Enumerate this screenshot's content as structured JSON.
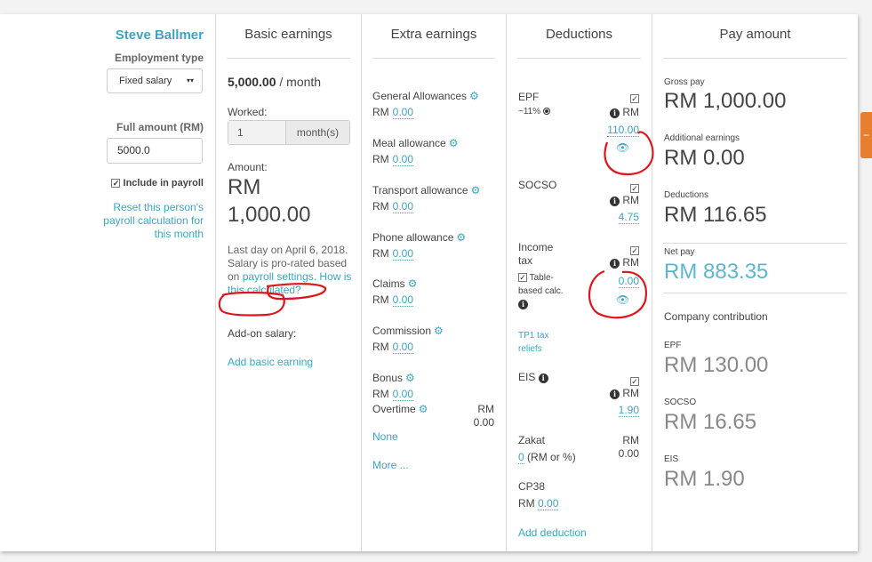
{
  "person": {
    "name": "Steve Ballmer",
    "employment_type_label": "Employment type",
    "employment_type_value": "Fixed salary",
    "full_amount_label": "Full amount (RM)",
    "full_amount_value": "5000.0",
    "include_label": "Include in payroll",
    "reset_link": "Reset this person's payroll calculation for this month"
  },
  "basic": {
    "title": "Basic earnings",
    "rate": "5,000.00",
    "rate_unit": "/ month",
    "worked_label": "Worked:",
    "worked_value": "1",
    "worked_unit": "month(s)",
    "amount_label": "Amount:",
    "amount_currency": "RM",
    "amount_value": "1,000.00",
    "note_text": "Last day on April 6, 2018. Salary is pro-rated based on",
    "note_link": "payroll settings.",
    "how_link": "How is this calculated?",
    "addon_label": "Add-on salary:",
    "add_basic": "Add basic earning"
  },
  "extra": {
    "title": "Extra earnings",
    "currency": "RM",
    "items": [
      {
        "label": "General Allowances",
        "value": "0.00"
      },
      {
        "label": "Meal allowance",
        "value": "0.00"
      },
      {
        "label": "Transport allowance",
        "value": "0.00"
      },
      {
        "label": "Phone allowance",
        "value": "0.00"
      },
      {
        "label": "Claims",
        "value": "0.00"
      },
      {
        "label": "Commission",
        "value": "0.00"
      },
      {
        "label": "Bonus",
        "value": "0.00"
      }
    ],
    "overtime_label": "Overtime",
    "overtime_currency": "RM",
    "overtime_value": "0.00",
    "none_link": "None",
    "more_link": "More ..."
  },
  "deductions": {
    "title": "Deductions",
    "currency": "RM",
    "epf_label": "EPF",
    "epf_rate": "~11%",
    "epf_value": "110.00",
    "socso_label": "SOCSO",
    "socso_value": "4.75",
    "income_tax_label_1": "Income",
    "income_tax_label_2": "tax",
    "income_tax_value": "0.00",
    "table_calc_1": "Table-",
    "table_calc_2": "based calc.",
    "tp1_link_1": "TP1 tax",
    "tp1_link_2": "reliefs",
    "eis_label": "EIS",
    "eis_value": "1.90",
    "zakat_label": "Zakat",
    "zakat_input": "0",
    "zakat_hint": "(RM or %)",
    "zakat_currency": "RM",
    "zakat_value": "0.00",
    "cp38_label": "CP38",
    "cp38_currency": "RM",
    "cp38_value": "0.00",
    "add_deduction": "Add deduction"
  },
  "pay": {
    "title": "Pay amount",
    "gross_label": "Gross pay",
    "gross_value": "RM 1,000.00",
    "additional_label": "Additional earnings",
    "additional_value": "RM 0.00",
    "deductions_label": "Deductions",
    "deductions_value": "RM 116.65",
    "net_label": "Net pay",
    "net_value": "RM 883.35",
    "company_label": "Company contribution",
    "c_epf_label": "EPF",
    "c_epf_value": "RM 130.00",
    "c_socso_label": "SOCSO",
    "c_socso_value": "RM 16.65",
    "c_eis_label": "EIS",
    "c_eis_value": "RM 1.90"
  },
  "icons": {
    "gear": "gear-icon",
    "info": "info-icon",
    "eye": "eye-icon",
    "dropdown": "dropdown-arrow-icon",
    "checkbox": "checkbox-icon"
  },
  "colors": {
    "accent": "#3aa6c4",
    "net_pay": "#5bb7cf",
    "orange_tab": "#e87f2f",
    "annotation": "#e0151b"
  }
}
